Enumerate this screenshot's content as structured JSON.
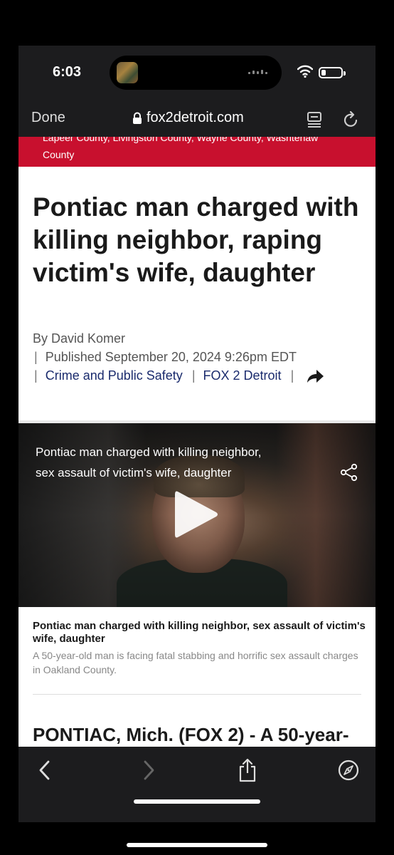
{
  "status_bar": {
    "time": "6:03"
  },
  "browser": {
    "done_label": "Done",
    "url": "fox2detroit.com"
  },
  "banner": {
    "line1": "Lapeer County, Livingston County, Wayne County, Washtenaw",
    "line2": "County"
  },
  "article": {
    "headline": "Pontiac man charged with killing neighbor, raping victim's wife, daughter",
    "byline": "By David Komer",
    "published_label": "Published",
    "published_date": "September 20, 2024 9:26pm EDT",
    "category": "Crime and Public Safety",
    "source": "FOX 2 Detroit",
    "lede": "PONTIAC, Mich. (FOX 2) - A 50-year-"
  },
  "video": {
    "title": "Pontiac man charged with killing neighbor, sex assault of victim's wife, daughter"
  },
  "caption": {
    "title": "Pontiac man charged with killing neighbor, sex assault of victim's wife, daughter",
    "description": "A 50-year-old man is facing fatal stabbing and horrific sex assault charges in Oakland County."
  },
  "colors": {
    "banner_red": "#c8102e",
    "link_navy": "#1a2b6d",
    "chrome_dark": "#1c1c1e"
  },
  "icons": {
    "status": [
      "wifi-icon",
      "battery-icon"
    ],
    "navbar": [
      "lock-icon",
      "reader-icon",
      "reload-icon"
    ],
    "toolbar": [
      "back-icon",
      "forward-icon",
      "share-icon",
      "compass-icon"
    ]
  }
}
